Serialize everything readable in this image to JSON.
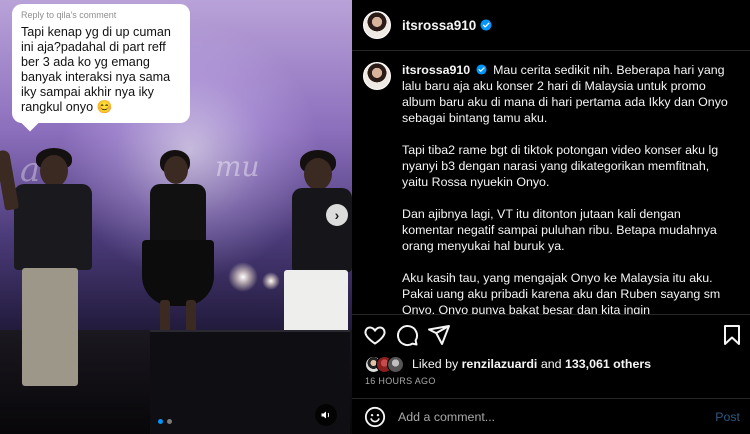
{
  "media": {
    "comment_reply_to": "Reply to qila's comment",
    "comment_text": "Tapi kenap yg di up cuman ini aja?padahal di part reff ber 3 ada ko yg emang banyak interaksi nya sama iky sampai akhir nya iky rangkul onyo 😊",
    "background_text_left": "ati",
    "background_text_right": "mu"
  },
  "header": {
    "username": "itsrossa910"
  },
  "caption": {
    "username": "itsrossa910",
    "paragraphs": [
      "Mau cerita sedikit nih. Beberapa hari yang lalu baru aja aku konser 2 hari di Malaysia untuk promo album baru aku di mana di hari pertama ada Ikky dan Onyo sebagai bintang tamu aku.",
      "Tapi tiba2 rame bgt di tiktok potongan video konser aku lg nyanyi b3 dengan narasi yang dikategorikan memfitnah, yaitu Rossa nyuekin Onyo.",
      "Dan ajibnya lagi, VT itu ditonton jutaan kali dengan komentar negatif sampai puluhan ribu. Betapa mudahnya orang menyukai hal buruk ya.",
      "Aku kasih tau, yang mengajak Onyo ke Malaysia itu aku. Pakai uang aku pribadi karena aku dan Ruben sayang sm Onyo. Onyo punya bakat besar dan kita ingin mempromosikan Onyo di Malaysia."
    ]
  },
  "likes": {
    "prefix": "Liked by",
    "user": "renzilazuardi",
    "middle": "and",
    "count": "133,061 others"
  },
  "timestamp": "16 HOURS AGO",
  "comment_box": {
    "placeholder": "Add a comment...",
    "post_label": "Post"
  },
  "colors": {
    "verified": "#0095f6",
    "post_button": "#2d5a83",
    "carousel_active": "#0095f6"
  }
}
